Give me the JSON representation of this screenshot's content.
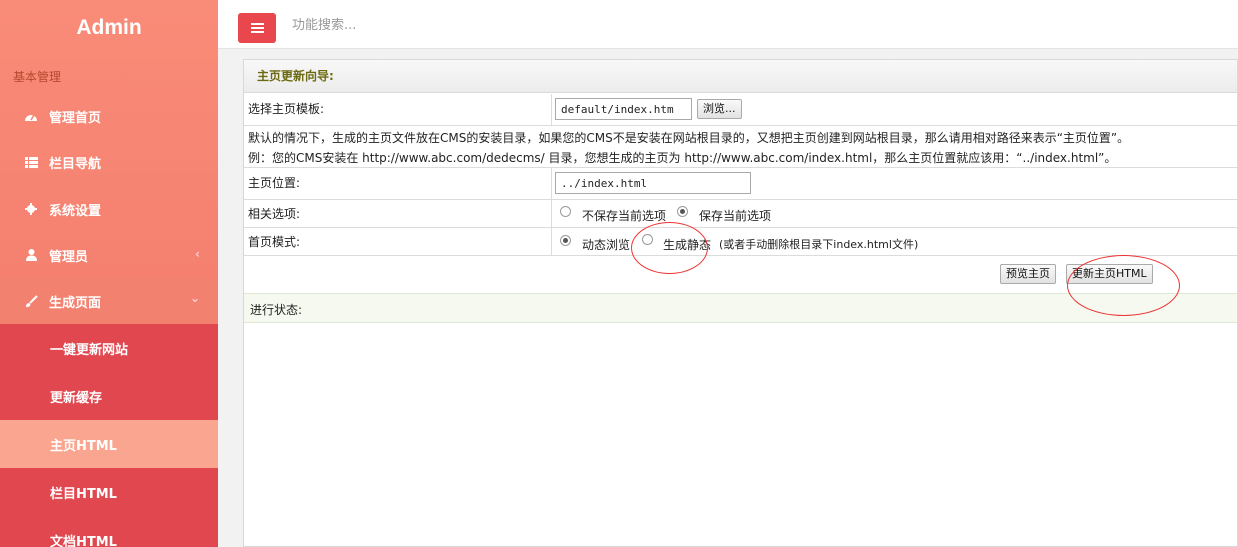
{
  "brand": "Admin",
  "sidebar": {
    "section_title": "基本管理",
    "items": [
      {
        "label": "管理首页",
        "icon": "dashboard-icon"
      },
      {
        "label": "栏目导航",
        "icon": "list-icon"
      },
      {
        "label": "系统设置",
        "icon": "gear-icon"
      },
      {
        "label": "管理员",
        "icon": "user-icon"
      },
      {
        "label": "生成页面",
        "icon": "brush-icon"
      }
    ],
    "sub_items": [
      {
        "label": "一键更新网站"
      },
      {
        "label": "更新缓存"
      },
      {
        "label": "主页HTML"
      },
      {
        "label": "栏目HTML"
      },
      {
        "label": "文档HTML"
      }
    ],
    "chevron_left": "‹",
    "chevron_down": "⌄"
  },
  "topbar": {
    "search_placeholder": "功能搜索..."
  },
  "panel": {
    "title": "主页更新向导:",
    "template_label": "选择主页模板:",
    "template_value": "default/index.htm",
    "browse_label": "浏览...",
    "note_line1": "默认的情况下，生成的主页文件放在CMS的安装目录，如果您的CMS不是安装在网站根目录的，又想把主页创建到网站根目录，那么请用相对路径来表示“主页位置”。",
    "note_line2": "例：您的CMS安装在 http://www.abc.com/dedecms/ 目录，您想生成的主页为 http://www.abc.com/index.html，那么主页位置就应该用：“../index.html”。",
    "position_label": "主页位置:",
    "position_value": "../index.html",
    "options_label": "相关选项:",
    "option_nosave": "不保存当前选项",
    "option_save": "保存当前选项",
    "mode_label": "首页模式:",
    "mode_dynamic": "动态浏览",
    "mode_static": "生成静态",
    "mode_static_hint": "(或者手动删除根目录下index.html文件)",
    "preview_button": "预览主页",
    "update_button": "更新主页HTML",
    "status_label": "进行状态:"
  },
  "colors": {
    "sidebar_gradient_top": "#f98c78",
    "submenu_bg": "#e0474f",
    "submenu_active_bg": "#f9a58f",
    "accent_button": "#e8474d",
    "panel_title_text": "#6b6a10"
  }
}
